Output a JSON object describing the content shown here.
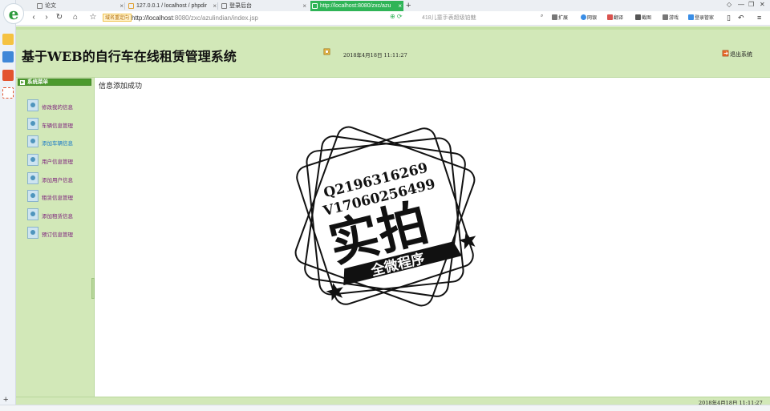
{
  "browser": {
    "tabs": [
      {
        "title": "论文",
        "active": false
      },
      {
        "title": "127.0.0.1 / localhost / phpdir",
        "active": false
      },
      {
        "title": "登录后台",
        "active": false
      },
      {
        "title": "http://localhost:8080/zxc/azu",
        "active": true
      }
    ],
    "new_tab_label": "+",
    "site_badge": "域名重定向",
    "url_host": "http://localhost",
    "url_rest": ":8080/zxc/azulindian/index.jsp",
    "search_placeholder": "418儿童手表超级铂魅",
    "toolbar": [
      {
        "label": "扩展",
        "icon": "extension-icon",
        "color": "#777777"
      },
      {
        "label": "网银",
        "icon": "bank-icon",
        "color": "#3a8ee6"
      },
      {
        "label": "翻译",
        "icon": "translate-icon",
        "color": "#d9534f"
      },
      {
        "label": "截图",
        "icon": "scissors-icon",
        "color": "#555555"
      },
      {
        "label": "游戏",
        "icon": "game-icon",
        "color": "#777777"
      },
      {
        "label": "登录管家",
        "icon": "login-manager-icon",
        "color": "#3a8ee6"
      }
    ]
  },
  "header": {
    "title": "基于WEB的自行车在线租赁管理系统",
    "datetime": "2018年4月18日 11:11:27",
    "logout_label": "退出系统"
  },
  "sidebar": {
    "heading": "系统菜单",
    "items": [
      {
        "label": "修改我的信息"
      },
      {
        "label": "车辆信息管理"
      },
      {
        "label": "添加车辆信息"
      },
      {
        "label": "用户信息管理"
      },
      {
        "label": "添加用户信息"
      },
      {
        "label": "租赁信息管理"
      },
      {
        "label": "添加租赁信息"
      },
      {
        "label": "预订信息管理"
      }
    ]
  },
  "content": {
    "message": "信息添加成功",
    "stamp": {
      "line1": "Q2196316269",
      "line2": "V17060256499",
      "big_text": "实拍",
      "ribbon_text": "全微程序"
    }
  },
  "footer": {
    "datetime": "2018年4月18日 11:11:27"
  },
  "colors": {
    "header_green": "#d2e8b8",
    "menu_head_green": "#4d9a2e",
    "active_tab_green": "#2fb457",
    "menu_link_purple": "#7a1a7a",
    "menu_link_blue": "#1677c8"
  }
}
